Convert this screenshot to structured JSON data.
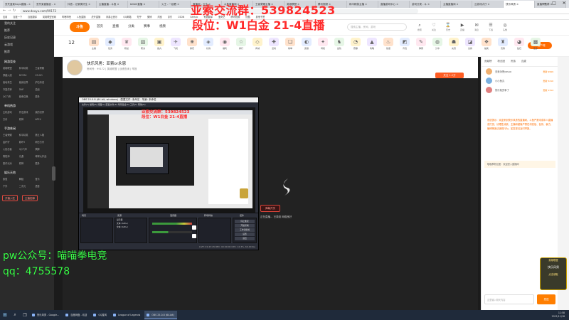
{
  "browser": {
    "tabs": [
      "丢失蓝某hoyo直播 - ×",
      "丢失某直播自 - ×",
      "抖音 - 记录美好生 ×",
      "主播直播 - 斗鱼 ×",
      "bilibili直播 ×",
      "火王 - 一起看 ×",
      "直播间 - 云生 ×",
      "斗鱼直播间 ×",
      "王者荣耀主播 ×",
      "英雄联盟 ×",
      "腾讯视频 ×",
      "和平精英主播 ×",
      "直播游戏中心 ×",
      "游戏分类 - 斗 ×",
      "主播直播间 ×",
      "云游戏大厅 ×",
      "快乐风男 ×",
      "直播间推荐 ×"
    ],
    "window_controls": [
      "—",
      "□",
      "✕"
    ],
    "url": "www.douyu.com/99172",
    "bookmarks": [
      "应用",
      "百度一下",
      "百度翻译",
      "英雄联盟官网",
      "哔哩哔哩",
      "斗鱼直播",
      "虎牙直播",
      "网易云音乐",
      "QQ邮箱",
      "知乎",
      "微博",
      "淘宝",
      "京东",
      "CSDN",
      "GitHub",
      "有道翻译",
      "爱奇艺",
      "腾讯视频",
      "优酷",
      "其他书签"
    ]
  },
  "sidebar": {
    "top_items": [
      "我的关注",
      "推荐",
      "历史记录",
      "云游戏",
      "推荐"
    ],
    "sections": [
      {
        "title": "网游竞技",
        "items": [
          "英雄联盟",
          "和平精英",
          "王者荣耀",
          "穿越火线",
          "DOTA2",
          "CS:GO",
          "绝地求生",
          "魔兽世界",
          "炉石传说",
          "守望先锋",
          "DNF",
          "逆战",
          "QQ飞车",
          "使命召唤",
          "更多"
        ]
      },
      {
        "title": "单机热游",
        "items": [
          "主机游戏",
          "怀旧游戏",
          "我的世界",
          "方舟",
          "原神",
          "APEX"
        ]
      },
      {
        "title": "手游休闲",
        "items": [
          "王者荣耀",
          "和平精英",
          "第五人格",
          "金铲铲",
          "崩坏3",
          "明日方舟",
          "火影忍者",
          "QQ飞车",
          "棋牌",
          "阴阳师",
          "光遇",
          "球球大作战",
          "蛋仔派对",
          "原神",
          "更多"
        ]
      },
      {
        "title": "娱乐天地",
        "items": [
          "颜值",
          "舞蹈",
          "音乐",
          "户外",
          "二次元",
          "语音"
        ]
      }
    ],
    "buttons": [
      "开播入驻",
      "主播招募"
    ]
  },
  "header": {
    "logo": "斗鱼",
    "nav": [
      "首页",
      "直播",
      "分类",
      "赛事",
      "视频"
    ],
    "search_placeholder": "搜索主播、房间、游戏",
    "icons": [
      {
        "glyph": "⌕",
        "label": "搜索"
      },
      {
        "glyph": "♡",
        "label": "关注"
      },
      {
        "glyph": "⌛",
        "label": "历史"
      },
      {
        "glyph": "▶",
        "label": "直播"
      },
      {
        "glyph": "✉",
        "label": "消息"
      },
      {
        "glyph": "☰",
        "label": "下载"
      },
      {
        "glyph": "◎",
        "label": "头像"
      }
    ]
  },
  "gift_bar": {
    "count": "12",
    "icons": [
      "▤",
      "◆",
      "♛",
      "▧",
      "▣",
      "✈",
      "❀",
      "◈",
      "◉",
      "☆",
      "◇",
      "✚",
      "❏",
      "◐",
      "✦",
      "♞",
      "◔",
      "▲",
      "♨",
      "◩",
      "✎",
      "◍",
      "☗",
      "◪",
      "❖",
      "♜",
      "◕",
      "▩"
    ],
    "labels": [
      "主播",
      "任务",
      "粉丝",
      "帮派",
      "鱼丸",
      "飞机",
      "鲜花",
      "礼物",
      "福利",
      "排行",
      "商城",
      "活动",
      "榜单",
      "贵族",
      "特权",
      "战队",
      "赛事",
      "攻略",
      "热度",
      "背包",
      "弹幕",
      "分享",
      "充值",
      "兑换",
      "抽奖",
      "竞猜",
      "钻石",
      "更多"
    ],
    "pc_button": "PC客户端"
  },
  "room": {
    "title": "快乐风男：亚索or永恩",
    "subtitle": "房间号：99172  |  英雄联盟  |  战绩查询  |  举报",
    "follow": "关注 1.2万"
  },
  "stream": {
    "overlay_group": "亚索交流群：539824523",
    "overlay_rank": "段位：W1白金 21-4直播",
    "overlay_pw": "pw公众号：喵喵拳电竞",
    "overlay_qq": "qq：4755578",
    "danmu_toggle": "弹幕开关",
    "status_note": "正在直播... 已录制 网络良好"
  },
  "obs": {
    "title": "OBS 25.0.8 (64-bit, windows) - 配置文件: 未命名 - 场景: 未命名",
    "menu": "文件(F)  编辑(E)  视图(V)  配置文件(P)  场景集合(S)  工具(T)  帮助(H)",
    "inner_overlay_line1": "亚索交流群：539824523",
    "inner_overlay_line2": "段位：W1白金 21-4直播",
    "docks": [
      "场景",
      "来源",
      "混音器",
      "转场特效",
      "控件"
    ],
    "sources": [
      "显示器",
      "文本 (GDI+)",
      "文本 (GDI+)"
    ],
    "controls": [
      "停止推流",
      "开始录制",
      "工作室模式",
      "设置",
      "退出"
    ],
    "status": "LIVE: 01:23:45  REC: 00:00:00  CPU: 12.3%, 60.00 fps"
  },
  "chat": {
    "tabs": [
      "贡献榜",
      "粉丝团",
      "贵族",
      "连麦"
    ],
    "ranks": [
      {
        "name": "亚索永恩yasuo",
        "badge": "贡献 9999"
      },
      {
        "name": "小小鱼丸",
        "badge": "贡献 5210"
      },
      {
        "name": "快乐就完事了",
        "badge": "贡献 1314"
      }
    ],
    "notice": "系统提示：欢迎来到快乐风男的直播间，斗鱼严禁未成年人直播或打赏，请理性消费，主播和超管严禁任何低俗、色情、暴力、赌博等违法违规行为，如发现请及时举报。",
    "message": "喵喵拳粉丝团：欢迎进入直播间",
    "input_placeholder": "这里输入聊天内容",
    "send": "发送"
  },
  "ad": [
    "英雄联盟",
    "快乐风男",
    "点击领取"
  ],
  "taskbar": {
    "items": [
      "快乐风男 - Google...",
      "百度网盘 - 欢迎",
      "QQ旋风",
      "League of Legends",
      "OBS 25.0.8 (64-bit)"
    ],
    "time": "11:58",
    "date": "2021/11/18"
  },
  "colors": {
    "accent": "#ff7700",
    "overlay_red": "#ff2a2a",
    "overlay_green": "#3cff4a"
  }
}
